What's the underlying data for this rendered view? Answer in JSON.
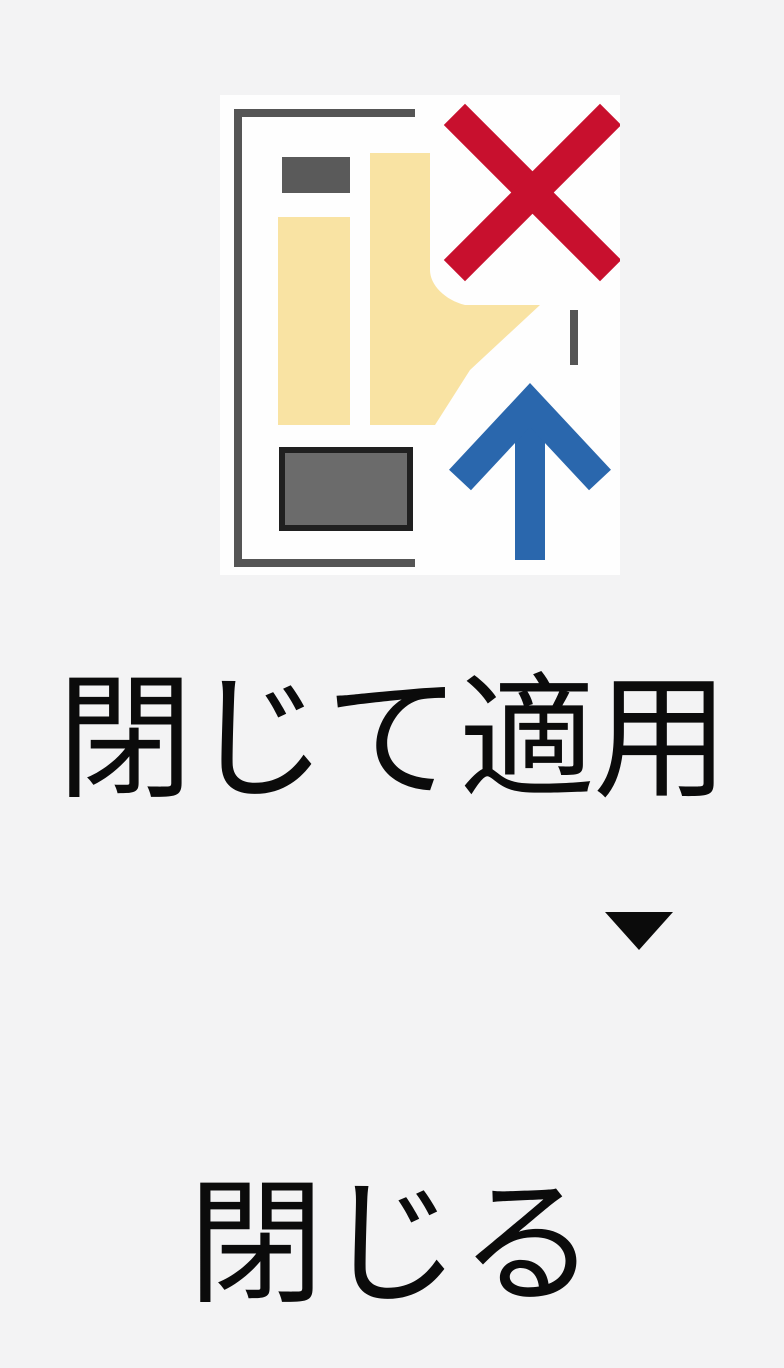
{
  "ribbon_group": {
    "name": "閉じる",
    "buttons": [
      {
        "label": "閉じて適用",
        "icon": "close-and-apply-icon",
        "has_dropdown": true
      }
    ]
  },
  "colors": {
    "background": "#f3f3f4",
    "close_x": "#c8102e",
    "apply_arrow": "#2a67ad",
    "table_highlight": "#f9e3a3",
    "table_border": "#555555",
    "text": "#0b0b0b"
  }
}
